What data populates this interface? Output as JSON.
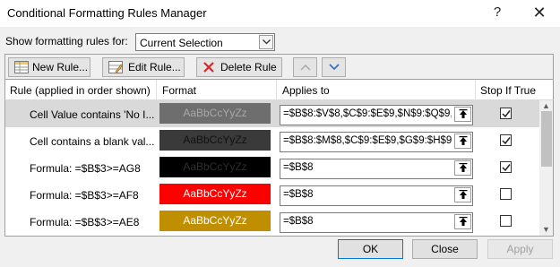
{
  "window": {
    "title": "Conditional Formatting Rules Manager",
    "help_glyph": "?",
    "close_glyph": "✕"
  },
  "scope": {
    "label": "Show formatting rules for:",
    "value": "Current Selection"
  },
  "toolbar": {
    "new_rule": "New Rule...",
    "edit_rule": "Edit Rule...",
    "delete_rule": "Delete Rule"
  },
  "columns": {
    "rule": "Rule (applied in order shown)",
    "format": "Format",
    "applies_to": "Applies to",
    "stop_if_true": "Stop If True"
  },
  "rules": [
    {
      "rule": "Cell Value contains 'No I...",
      "preview": "AaBbCcYyZz",
      "bg": "#6e6e6e",
      "fg": "#a8a8a8",
      "applies_to": "=$B$8:$V$8,$C$9:$E$9,$N$9:$Q$9,$",
      "stop": true,
      "selected": true
    },
    {
      "rule": "Cell contains a blank val...",
      "preview": "AaBbCcYyZz",
      "bg": "#3a3a3a",
      "fg": "#111111",
      "applies_to": "=$B$8:$M$8,$C$9:$E$9,$G$9:$H$9,$",
      "stop": true,
      "selected": false
    },
    {
      "rule": "Formula: =$B$3>=AG8",
      "preview": "AaBbCcYyZz",
      "bg": "#000000",
      "fg": "#2e2e2e",
      "applies_to": "=$B$8",
      "stop": true,
      "selected": false
    },
    {
      "rule": "Formula: =$B$3>=AF8",
      "preview": "AaBbCcYyZz",
      "bg": "#ff0000",
      "fg": "#ffffff",
      "applies_to": "=$B$8",
      "stop": false,
      "selected": false
    },
    {
      "rule": "Formula: =$B$3>=AE8",
      "preview": "AaBbCcYyZz",
      "bg": "#bf8f00",
      "fg": "#ffffff",
      "applies_to": "=$B$8",
      "stop": false,
      "selected": false
    }
  ],
  "buttons": {
    "ok": "OK",
    "close": "Close",
    "apply": "Apply"
  }
}
